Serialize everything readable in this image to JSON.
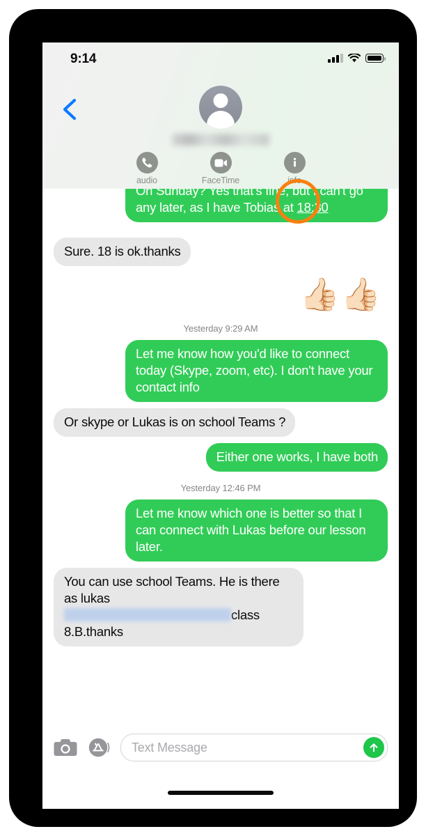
{
  "status_bar": {
    "time": "9:14",
    "signal_icon": "cellular-bars-icon",
    "wifi_icon": "wifi-icon",
    "battery_icon": "battery-full-icon"
  },
  "header": {
    "back_icon": "chevron-left-icon",
    "avatar_icon": "person-avatar-icon",
    "contact_name": "",
    "contact_name_state": "blurred-redacted",
    "actions": [
      {
        "label": "audio",
        "icon": "phone-icon",
        "highlighted": false
      },
      {
        "label": "FaceTime",
        "icon": "video-camera-icon",
        "highlighted": false
      },
      {
        "label": "info",
        "icon": "info-circle-icon",
        "highlighted": true
      }
    ],
    "highlight_color": "#f98010"
  },
  "conversation": {
    "messages": [
      {
        "type": "text",
        "side": "out",
        "text_before_link": "On Sunday? Yes that's fine, but I can't go any later, as I have Tobias at ",
        "link_text": "18:30",
        "text_after_link": "",
        "partially_scrolled": true
      },
      {
        "type": "text",
        "side": "in",
        "text": "Sure. 18 is ok.thanks"
      },
      {
        "type": "emoji",
        "side": "out",
        "emoji": "👍🏻👍🏻"
      },
      {
        "type": "timestamp",
        "text": "Yesterday 9:29 AM"
      },
      {
        "type": "text",
        "side": "out",
        "text": "Let me know how you'd like to connect today (Skype, zoom, etc). I don't have your contact info"
      },
      {
        "type": "text",
        "side": "in",
        "text": "Or skype or Lukas is on school Teams ?"
      },
      {
        "type": "text",
        "side": "out",
        "text": "Either one works, I have both"
      },
      {
        "type": "timestamp",
        "text": "Yesterday 12:46 PM"
      },
      {
        "type": "text",
        "side": "out",
        "text": "Let me know which one is better so that I can connect with Lukas before our lesson later."
      },
      {
        "type": "text-redacted",
        "side": "in",
        "line1": "You can use school Teams. He is there as lukas",
        "redacted_note": "blurred-blue-redaction",
        "after_redaction": "class",
        "line3": "8.B.thanks"
      }
    ]
  },
  "input_bar": {
    "camera_icon": "camera-icon",
    "appstore_icon": "app-store-icon",
    "placeholder": "Text Message",
    "value": "",
    "send_icon": "arrow-up-icon",
    "send_color": "#1ec64a"
  },
  "home_indicator": "home-indicator",
  "colors": {
    "outgoing_bubble": "#31cc57",
    "incoming_bubble": "#e7e7e8",
    "accent_blue": "#0a7aff",
    "timestamp_gray": "#86868a",
    "highlight_orange": "#f98010"
  }
}
